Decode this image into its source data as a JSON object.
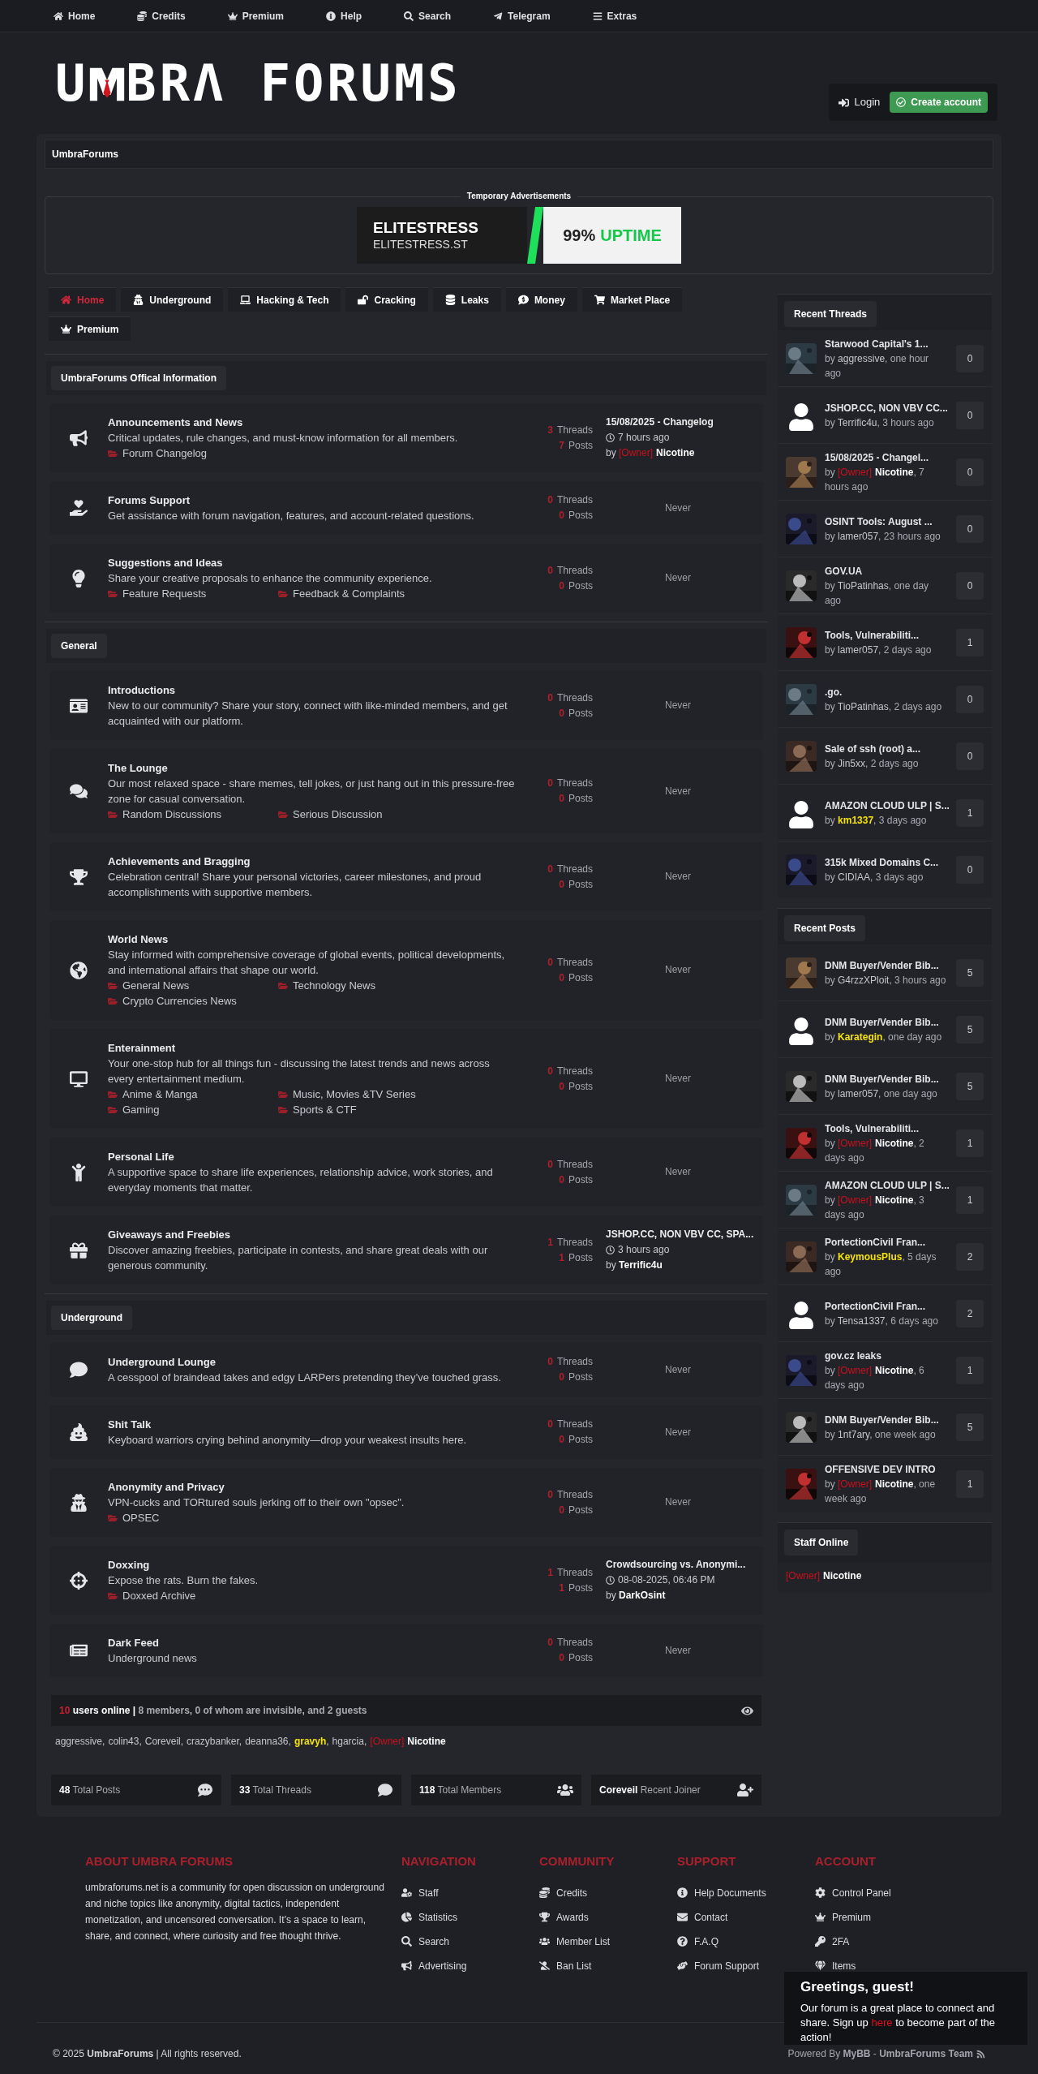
{
  "top_nav": [
    "Home",
    "Credits",
    "Premium",
    "Help",
    "Search",
    "Telegram",
    "Extras"
  ],
  "logo": {
    "left": "U",
    "right": "BRΛ FORUMS"
  },
  "account": {
    "login": "Login",
    "create": "Create account"
  },
  "breadcrumb": "UmbraForums",
  "ad": {
    "label": "Temporary Advertisements",
    "brand": "ELITESTRESS",
    "domain": "ELITESTRESS.ST",
    "percent": "99%",
    "word": "UPTIME"
  },
  "tabs": [
    {
      "label": "Home",
      "selected": true
    },
    {
      "label": "Underground",
      "selected": false
    },
    {
      "label": "Hacking & Tech",
      "selected": false
    },
    {
      "label": "Cracking",
      "selected": false
    },
    {
      "label": "Leaks",
      "selected": false
    },
    {
      "label": "Money",
      "selected": false
    },
    {
      "label": "Market Place",
      "selected": false
    },
    {
      "label": "Premium",
      "selected": false
    }
  ],
  "categories": [
    {
      "title": "UmbraForums Offical Information",
      "forums": [
        {
          "title": "Announcements and News",
          "description": "Critical updates, rule changes, and must-know information for all members.",
          "subforums": [
            "Forum Changelog"
          ],
          "threads": "3",
          "threads_label": "Threads",
          "posts": "7",
          "posts_label": "Posts",
          "last_post": {
            "kind": "post",
            "title": "15/08/2025 - Changelog",
            "time": "7 hours ago",
            "by": "by",
            "tag": "[Owner]",
            "user": "Nicotine",
            "color": "#ffffff",
            "bold": true
          }
        },
        {
          "title": "Forums Support",
          "description": "Get assistance with forum navigation, features, and account-related questions.",
          "threads": "0",
          "threads_label": "Threads",
          "posts": "0",
          "posts_label": "Posts",
          "last_post": {
            "kind": "never",
            "text": "Never"
          }
        },
        {
          "title": "Suggestions and Ideas",
          "description": "Share your creative proposals to enhance the community experience.",
          "subforums": [
            "Feature Requests",
            "Feedback & Complaints"
          ],
          "threads": "0",
          "threads_label": "Threads",
          "posts": "0",
          "posts_label": "Posts",
          "last_post": {
            "kind": "never",
            "text": "Never"
          }
        }
      ]
    },
    {
      "title": "General",
      "forums": [
        {
          "title": "Introductions",
          "description": "New to our community? Share your story, connect with like-minded members, and get acquainted with our platform.",
          "threads": "0",
          "threads_label": "Threads",
          "posts": "0",
          "posts_label": "Posts",
          "last_post": {
            "kind": "never",
            "text": "Never"
          }
        },
        {
          "title": "The Lounge",
          "description": "Our most relaxed space - share memes, tell jokes, or just hang out in this pressure-free zone for casual conversation.",
          "subforums": [
            "Random Discussions",
            "Serious Discussion"
          ],
          "threads": "0",
          "threads_label": "Threads",
          "posts": "0",
          "posts_label": "Posts",
          "last_post": {
            "kind": "never",
            "text": "Never"
          }
        },
        {
          "title": "Achievements and Bragging",
          "description": "Celebration central! Share your personal victories, career milestones, and proud accomplishments with supportive members.",
          "threads": "0",
          "threads_label": "Threads",
          "posts": "0",
          "posts_label": "Posts",
          "last_post": {
            "kind": "never",
            "text": "Never"
          }
        },
        {
          "title": "World News",
          "description": "Stay informed with comprehensive coverage of global events, political developments, and international affairs that shape our world.",
          "subforums": [
            "General News",
            "Technology News",
            "Crypto Currencies News"
          ],
          "threads": "0",
          "threads_label": "Threads",
          "posts": "0",
          "posts_label": "Posts",
          "last_post": {
            "kind": "never",
            "text": "Never"
          }
        },
        {
          "title": "Enterainment",
          "description": "Your one-stop hub for all things fun - discussing the latest trends and news across every entertainment medium.",
          "subforums": [
            "Anime & Manga",
            "Music, Movies &TV Series",
            "Gaming",
            "Sports & CTF"
          ],
          "threads": "0",
          "threads_label": "Threads",
          "posts": "0",
          "posts_label": "Posts",
          "last_post": {
            "kind": "never",
            "text": "Never"
          }
        },
        {
          "title": "Personal Life",
          "description": "A supportive space to share life experiences, relationship advice, work stories, and everyday moments that matter.",
          "threads": "0",
          "threads_label": "Threads",
          "posts": "0",
          "posts_label": "Posts",
          "last_post": {
            "kind": "never",
            "text": "Never"
          }
        },
        {
          "title": "Giveaways and Freebies",
          "description": "Discover amazing freebies, participate in contests, and share great deals with our generous community.",
          "threads": "1",
          "threads_label": "Threads",
          "posts": "1",
          "posts_label": "Posts",
          "last_post": {
            "kind": "post",
            "title": "JSHOP.CC, NON VBV CC, SPA...",
            "time": "3 hours ago",
            "by": "by",
            "user": "Terrific4u",
            "color": "#ffffff",
            "bold": true
          }
        }
      ]
    },
    {
      "title": "Underground",
      "forums": [
        {
          "title": "Underground Lounge",
          "description": "A cesspool of braindead takes and edgy LARPers pretending they’ve touched grass.",
          "threads": "0",
          "threads_label": "Threads",
          "posts": "0",
          "posts_label": "Posts",
          "last_post": {
            "kind": "never",
            "text": "Never"
          }
        },
        {
          "title": "Shit Talk",
          "description": "Keyboard warriors crying behind anonymity—drop your weakest insults here.",
          "threads": "0",
          "threads_label": "Threads",
          "posts": "0",
          "posts_label": "Posts",
          "last_post": {
            "kind": "never",
            "text": "Never"
          }
        },
        {
          "title": "Anonymity and Privacy",
          "description": "VPN-cucks and TORtured souls jerking off to their own \"opsec\".",
          "subforums": [
            "OPSEC"
          ],
          "threads": "0",
          "threads_label": "Threads",
          "posts": "0",
          "posts_label": "Posts",
          "last_post": {
            "kind": "never",
            "text": "Never"
          }
        },
        {
          "title": "Doxxing",
          "description": "Expose the rats. Burn the fakes.",
          "subforums": [
            "Doxxed Archive"
          ],
          "threads": "1",
          "threads_label": "Threads",
          "posts": "1",
          "posts_label": "Posts",
          "last_post": {
            "kind": "post",
            "title": "Crowdsourcing vs. Anonymi...",
            "time": "08-08-2025, 06:46 PM",
            "by": "by",
            "user": "DarkOsint",
            "color": "#ffffff",
            "bold": true
          }
        },
        {
          "title": "Dark Feed",
          "description": "Underground news",
          "threads": "0",
          "threads_label": "Threads",
          "posts": "0",
          "posts_label": "Posts",
          "last_post": {
            "kind": "never",
            "text": "Never"
          }
        }
      ]
    }
  ],
  "online": {
    "count": "10",
    "label": "users online",
    "separator": "|",
    "detail": "8 members, 0 of whom are invisible, and 2 guests",
    "users": [
      {
        "user": "aggressive",
        "color": "#c4c6cc",
        "bold": false,
        "after": ","
      },
      {
        "user": "colin43",
        "color": "#c4c6cc",
        "bold": false,
        "after": ","
      },
      {
        "user": "Coreveil",
        "color": "#c4c6cc",
        "bold": false,
        "after": ","
      },
      {
        "user": "crazybanker",
        "color": "#c4c6cc",
        "bold": false,
        "after": ","
      },
      {
        "user": "deanna36",
        "color": "#c4c6cc",
        "bold": false,
        "after": ","
      },
      {
        "user": "gravyh",
        "color": "#f5e20a",
        "bold": true,
        "after": ","
      },
      {
        "user": "hgarcia",
        "color": "#c4c6cc",
        "bold": false,
        "after": ","
      },
      {
        "user": "Nicotine",
        "tag": "[Owner]",
        "color": "#ffffff",
        "bold": true
      }
    ]
  },
  "stats": [
    {
      "value": "48",
      "label": "Total Posts"
    },
    {
      "value": "33",
      "label": "Total Threads"
    },
    {
      "value": "118",
      "label": "Total Members"
    },
    {
      "value": "Coreveil",
      "label": "Recent Joiner"
    }
  ],
  "sidebar": {
    "recent_threads": {
      "title": "Recent Threads",
      "items": [
        {
          "kind": "picture",
          "title": "Starwood Capital's 1...",
          "by": "by",
          "user": "aggressive",
          "color": "#c4c6cc",
          "bold": false,
          "time": ", one hour ago",
          "count": "0"
        },
        {
          "kind": "silhouette",
          "title": "JSHOP.CC, NON VBV CC...",
          "by": "by",
          "user": "Terrific4u",
          "color": "#c4c6cc",
          "bold": false,
          "time": ", 3 hours ago",
          "count": "0"
        },
        {
          "kind": "picture",
          "title": "15/08/2025 - Changel...",
          "by": "by",
          "tag": "[Owner]",
          "user": "Nicotine",
          "color": "#ffffff",
          "bold": true,
          "time": ", 7 hours ago",
          "count": "0"
        },
        {
          "kind": "picture",
          "title": "OSINT Tools: August ...",
          "by": "by",
          "user": "lamer057",
          "color": "#c4c6cc",
          "bold": false,
          "time": ", 23 hours ago",
          "count": "0"
        },
        {
          "kind": "picture",
          "title": "GOV.UA",
          "by": "by",
          "user": "TioPatinhas",
          "color": "#c4c6cc",
          "bold": false,
          "time": ", one day ago",
          "count": "0"
        },
        {
          "kind": "picture",
          "title": "Tools, Vulnerabiliti...",
          "by": "by",
          "user": "lamer057",
          "color": "#c4c6cc",
          "bold": false,
          "time": ", 2 days ago",
          "count": "1"
        },
        {
          "kind": "picture",
          "title": ".go.",
          "by": "by",
          "user": "TioPatinhas",
          "color": "#c4c6cc",
          "bold": false,
          "time": ", 2 days ago",
          "count": "0"
        },
        {
          "kind": "picture",
          "title": "Sale of ssh (root) a...",
          "by": "by",
          "user": "Jin5xx",
          "color": "#c4c6cc",
          "bold": false,
          "time": ", 2 days ago",
          "count": "0"
        },
        {
          "kind": "silhouette",
          "title": "AMAZON CLOUD ULP | S...",
          "by": "by",
          "user": "km1337",
          "color": "#f5e20a",
          "bold": true,
          "time": ", 3 days ago",
          "count": "1"
        },
        {
          "kind": "picture",
          "title": "315k Mixed Domains C...",
          "by": "by",
          "user": "CIDIAA",
          "color": "#c4c6cc",
          "bold": false,
          "time": ", 3 days ago",
          "count": "0"
        }
      ]
    },
    "recent_posts": {
      "title": "Recent Posts",
      "items": [
        {
          "kind": "picture",
          "title": "DNM Buyer/Vender Bib...",
          "by": "by",
          "user": "G4rzzXPloit",
          "color": "#c4c6cc",
          "bold": false,
          "time": ", 3 hours ago",
          "count": "5"
        },
        {
          "kind": "silhouette",
          "title": "DNM Buyer/Vender Bib...",
          "by": "by",
          "user": "Karategin",
          "color": "#f5e20a",
          "bold": true,
          "time": ", one day ago",
          "count": "5"
        },
        {
          "kind": "picture",
          "title": "DNM Buyer/Vender Bib...",
          "by": "by",
          "user": "lamer057",
          "color": "#c4c6cc",
          "bold": false,
          "time": ", one day ago",
          "count": "5"
        },
        {
          "kind": "picture",
          "title": "Tools, Vulnerabiliti...",
          "by": "by",
          "tag": "[Owner]",
          "user": "Nicotine",
          "color": "#ffffff",
          "bold": true,
          "time": ", 2 days ago",
          "count": "1"
        },
        {
          "kind": "picture",
          "title": "AMAZON CLOUD ULP | S...",
          "by": "by",
          "tag": "[Owner]",
          "user": "Nicotine",
          "color": "#ffffff",
          "bold": true,
          "time": ", 3 days ago",
          "count": "1"
        },
        {
          "kind": "picture",
          "title": "PortectionCivil Fran...",
          "by": "by",
          "user": "KeymousPlus",
          "color": "#f5e20a",
          "bold": true,
          "time": ", 5 days ago",
          "count": "2"
        },
        {
          "kind": "silhouette",
          "title": "PortectionCivil Fran...",
          "by": "by",
          "user": "Tensa1337",
          "color": "#c4c6cc",
          "bold": false,
          "time": ", 6 days ago",
          "count": "2"
        },
        {
          "kind": "picture",
          "title": "gov.cz leaks",
          "by": "by",
          "tag": "[Owner]",
          "user": "Nicotine",
          "color": "#ffffff",
          "bold": true,
          "time": ", 6 days ago",
          "count": "1"
        },
        {
          "kind": "picture",
          "title": "DNM Buyer/Vender Bib...",
          "by": "by",
          "user": "1nt7ary",
          "color": "#c4c6cc",
          "bold": false,
          "time": ", one week ago",
          "count": "5"
        },
        {
          "kind": "picture",
          "title": "OFFENSIVE DEV INTRO",
          "by": "by",
          "tag": "[Owner]",
          "user": "Nicotine",
          "color": "#ffffff",
          "bold": true,
          "time": ", one week ago",
          "count": "1"
        }
      ]
    },
    "staff_online": {
      "title": "Staff Online",
      "users": [
        {
          "tag": "[Owner]",
          "user": "Nicotine",
          "color": "#ffffff",
          "bold": true
        }
      ]
    }
  },
  "footer": {
    "about": {
      "title": "ABOUT UMBRA FORUMS",
      "text": "umbraforums.net is a community for open discussion on underground and niche topics like anonymity, digital tactics, independent monetization, and uncensored conversation. It’s a space to learn, share, and connect, where curiosity and free thought thrive."
    },
    "columns": [
      {
        "title": "NAVIGATION",
        "links": [
          "Staff",
          "Statistics",
          "Search",
          "Advertising"
        ]
      },
      {
        "title": "COMMUNITY",
        "links": [
          "Credits",
          "Awards",
          "Member List",
          "Ban List"
        ]
      },
      {
        "title": "SUPPORT",
        "links": [
          "Help Documents",
          "Contact",
          "F.A.Q",
          "Forum Support"
        ]
      },
      {
        "title": "ACCOUNT",
        "links": [
          "Control Panel",
          "Premium",
          "2FA",
          "Items"
        ]
      }
    ],
    "copyright": "© 2025 **UmbraForums** | All rights reserved.",
    "powered": "Powered By **MyBB** - **UmbraForums Team**"
  },
  "popup": {
    "title": "Greetings, guest!",
    "text_before": "Our forum is a great place to connect and share. Sign up",
    "link": "here",
    "text_after": "to become part of the action!"
  }
}
